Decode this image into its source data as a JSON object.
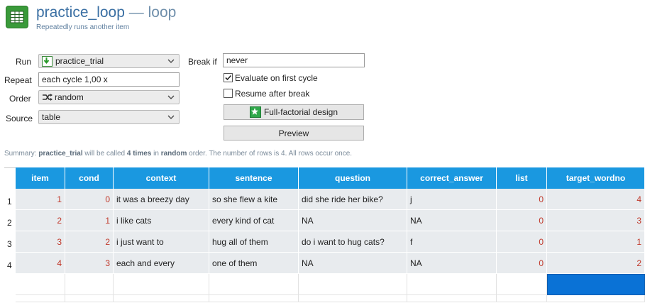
{
  "header": {
    "item_name": "practice_loop",
    "separator": "—",
    "item_type": "loop",
    "description": "Repeatedly runs another item"
  },
  "form": {
    "run_label": "Run",
    "run_value": "practice_trial",
    "repeat_label": "Repeat",
    "repeat_value": "each cycle 1,00 x",
    "order_label": "Order",
    "order_value": "random",
    "source_label": "Source",
    "source_value": "table",
    "break_if_label": "Break if",
    "break_if_value": "never",
    "evaluate_first_label": "Evaluate on first cycle",
    "evaluate_first_checked": true,
    "resume_after_break_label": "Resume after break",
    "resume_after_break_checked": false,
    "full_factorial_label": "Full-factorial design",
    "preview_label": "Preview"
  },
  "summary": {
    "prefix": "Summary:",
    "item": "practice_trial",
    "mid1": "will be called",
    "times": "4 times",
    "mid2": "in",
    "order": "random",
    "suffix": "order. The number of rows is 4. All rows occur once."
  },
  "table": {
    "columns": [
      "item",
      "cond",
      "context",
      "sentence",
      "question",
      "correct_answer",
      "list",
      "target_wordno"
    ],
    "rows": [
      {
        "num": "1",
        "cells": [
          "1",
          "0",
          "it was a breezy day",
          "so she flew a kite",
          "did she ride her bike?",
          "j",
          "0",
          "4"
        ]
      },
      {
        "num": "2",
        "cells": [
          "2",
          "1",
          "i like cats",
          "every kind of cat",
          "NA",
          "NA",
          "0",
          "3"
        ]
      },
      {
        "num": "3",
        "cells": [
          "3",
          "2",
          "i just want to",
          "hug all of them",
          "do i want to hug cats?",
          "f",
          "0",
          "1"
        ]
      },
      {
        "num": "4",
        "cells": [
          "4",
          "3",
          "each and every",
          "one of them",
          "NA",
          "NA",
          "0",
          "2"
        ]
      }
    ]
  },
  "colors": {
    "header_bg": "#1a98e0",
    "numeric_text": "#c0392b",
    "selection": "#0a72d6",
    "title": "#3a6fa3"
  },
  "icons": {
    "app": "table-grid-icon",
    "run": "green-arrow-down-icon",
    "order": "shuffle-icon",
    "full_factorial": "green-star-icon"
  }
}
